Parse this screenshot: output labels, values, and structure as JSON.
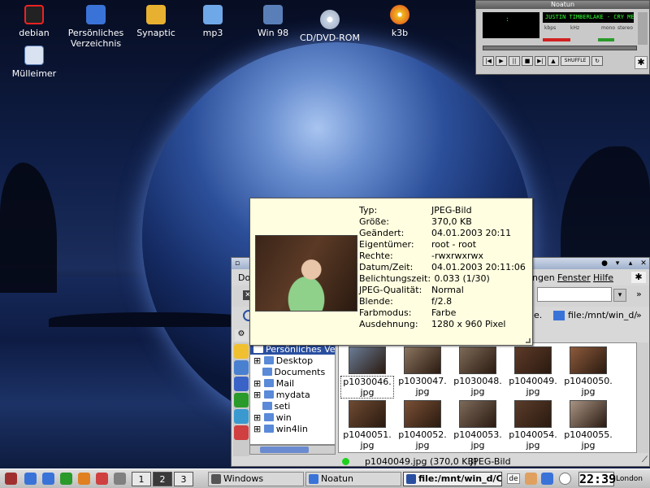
{
  "desktop": {
    "icons": [
      {
        "label": "debian",
        "icon": "debian-icon"
      },
      {
        "label": "Persönliches Verzeichnis",
        "icon": "home-folder-icon"
      },
      {
        "label": "Synaptic",
        "icon": "package-manager-icon"
      },
      {
        "label": "mp3",
        "icon": "music-folder-icon"
      },
      {
        "label": "Win 98",
        "icon": "windows-drive-icon"
      },
      {
        "label": "CD/DVD-ROM",
        "icon": "cdrom-icon"
      },
      {
        "label": "k3b",
        "icon": "burner-icon"
      },
      {
        "label": "Mülleimer",
        "icon": "trash-icon"
      }
    ],
    "accent": "#2a4fa0"
  },
  "noatun": {
    "title": "Noatun",
    "track_scroll": "JUSTIN TIMBERLAKE - CRY ME A R",
    "kbps": "kbps",
    "khz": "kHz",
    "mono": "mono",
    "stereo": "stereo",
    "shuffle": "SHUFFLE"
  },
  "tooltip": {
    "rows": [
      {
        "key": "Typ:",
        "value": "JPEG-Bild"
      },
      {
        "key": "Größe:",
        "value": "370,0 KB"
      },
      {
        "key": "Geändert:",
        "value": "04.01.2003 20:11"
      },
      {
        "key": "Eigentümer:",
        "value": "root - root"
      },
      {
        "key": "Rechte:",
        "value": "-rwxrwxrwx"
      },
      {
        "key": "Datum/Zeit:",
        "value": "04.01.2003 20:11:06"
      },
      {
        "key": "Belichtungszeit:",
        "value": " 0.033 (1/30)"
      },
      {
        "key": "JPEG-Qualität:",
        "value": "Normal"
      },
      {
        "key": "Blende:",
        "value": "f/2.8"
      },
      {
        "key": "Farbmodus:",
        "value": "Farbe"
      },
      {
        "key": "Ausdehnung:",
        "value": "1280 x 960 Pixel"
      }
    ]
  },
  "konqueror": {
    "menu_partial_left": "Do",
    "menu_partial_right": "ngen",
    "menu_fenster": "Fenster",
    "menu_hilfe": "Hilfe",
    "location_partial": "ge.",
    "location_url": "file:/mnt/win_d/",
    "tree": {
      "root": "Persönliches Verzeichnis",
      "items": [
        "Desktop",
        "Documents",
        "Mail",
        "mydata",
        "seti",
        "win",
        "win4lin"
      ]
    },
    "files": [
      {
        "name": "p1030046.",
        "ext": "jpg",
        "color": "#6a7c96"
      },
      {
        "name": "p1030047.",
        "ext": "jpg",
        "color": "#8b7460"
      },
      {
        "name": "p1030048.",
        "ext": "jpg",
        "color": "#7d6a58"
      },
      {
        "name": "p1040049.",
        "ext": "jpg",
        "color": "#5d3a28"
      },
      {
        "name": "p1040050.",
        "ext": "jpg",
        "color": "#8c5a3c"
      },
      {
        "name": "p1040051.",
        "ext": "jpg",
        "color": "#6e4a32"
      },
      {
        "name": "p1040052.",
        "ext": "jpg",
        "color": "#7a5036"
      },
      {
        "name": "p1040053.",
        "ext": "jpg",
        "color": "#7c6a5a"
      },
      {
        "name": "p1040054.",
        "ext": "jpg",
        "color": "#5a3c2a"
      },
      {
        "name": "p1040055.",
        "ext": "jpg",
        "color": "#a89484"
      }
    ],
    "status_file": "p1040049.jpg (370,0 KB)",
    "status_type": "JPEG-Bild"
  },
  "taskbar": {
    "pager": [
      "1",
      "2",
      "3"
    ],
    "tasks": [
      {
        "label": "Windows",
        "icon": "windows-list-icon"
      },
      {
        "label": "Noatun",
        "icon": "noatun-icon"
      },
      {
        "label": "file:/mnt/win_d/Cam",
        "icon": "konqueror-icon"
      }
    ],
    "keyboard_layout": "de",
    "clock": "22:39",
    "timezone": "London"
  }
}
